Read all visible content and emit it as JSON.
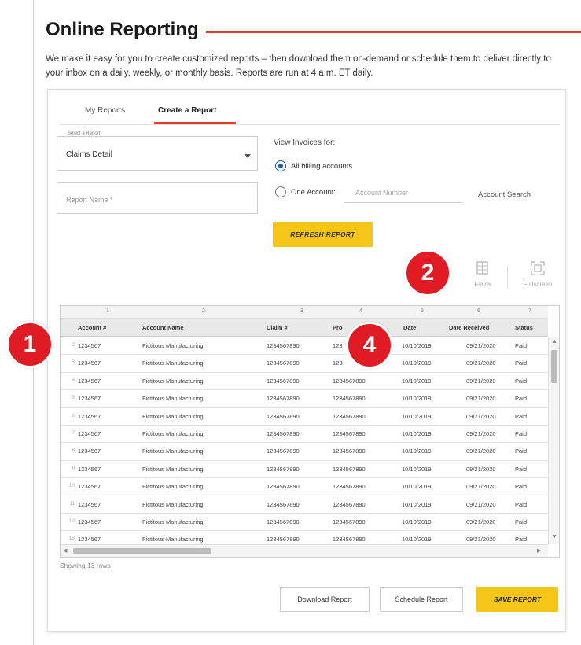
{
  "page": {
    "title": "Online Reporting",
    "intro": "We make it easy for you to create customized reports – then download them on-demand or schedule them to deliver directly to your inbox on a daily, weekly, or monthly basis. Reports are run at 4 a.m. ET daily."
  },
  "tabs": [
    {
      "label": "My Reports",
      "active": false
    },
    {
      "label": "Create a Report",
      "active": true
    }
  ],
  "form": {
    "select_legend": "Select a Report",
    "select_value": "Claims Detail",
    "report_name_placeholder": "Report Name *",
    "view_label": "View Invoices for:",
    "radio_all": "All billing accounts",
    "radio_one": "One Account:",
    "account_placeholder": "Account Number",
    "account_search": "Account Search",
    "refresh_label": "REFRESH REPORT"
  },
  "toolbar": {
    "fields_label": "Fields",
    "fields_icon": "grid-icon",
    "fullscreen_label": "Fullscreen",
    "fullscreen_icon": "expand-icon"
  },
  "grid": {
    "col_numbers": [
      "1",
      "2",
      "3",
      "4",
      "5",
      "6",
      "7"
    ],
    "headers": [
      "Account #",
      "Account Name",
      "Claim #",
      "Pro",
      "Date",
      "Date Received",
      "Status"
    ],
    "rows": [
      {
        "n": "2",
        "acct": "1234567",
        "name": "Fictitous Manufacturing",
        "claim": "1234567890",
        "pro": "123",
        "date": "10/10/2019",
        "received": "09/21/2020",
        "status": "Paid"
      },
      {
        "n": "3",
        "acct": "1234567",
        "name": "Fictitous Manufacturing",
        "claim": "1234567890",
        "pro": "123",
        "date": "10/10/2019",
        "received": "09/21/2020",
        "status": "Paid"
      },
      {
        "n": "4",
        "acct": "1234567",
        "name": "Fictitous Manufacturing",
        "claim": "1234567890",
        "pro": "1234567890",
        "date": "10/10/2019",
        "received": "09/21/2020",
        "status": "Paid"
      },
      {
        "n": "5",
        "acct": "1234567",
        "name": "Fictitous Manufacturing",
        "claim": "1234567890",
        "pro": "1234567890",
        "date": "10/10/2019",
        "received": "09/21/2020",
        "status": "Paid"
      },
      {
        "n": "6",
        "acct": "1234567",
        "name": "Fictitous Manufacturing",
        "claim": "1234567890",
        "pro": "1234567890",
        "date": "10/10/2019",
        "received": "09/21/2020",
        "status": "Paid"
      },
      {
        "n": "7",
        "acct": "1234567",
        "name": "Fictitous Manufacturing",
        "claim": "1234567890",
        "pro": "1234567890",
        "date": "10/10/2019",
        "received": "09/21/2020",
        "status": "Paid"
      },
      {
        "n": "8",
        "acct": "1234567",
        "name": "Fictitous Manufacturing",
        "claim": "1234567890",
        "pro": "1234567890",
        "date": "10/10/2019",
        "received": "09/21/2020",
        "status": "Paid"
      },
      {
        "n": "9",
        "acct": "1234567",
        "name": "Fictitous Manufacturing",
        "claim": "1234567890",
        "pro": "1234567890",
        "date": "10/10/2019",
        "received": "09/21/2020",
        "status": "Paid"
      },
      {
        "n": "10",
        "acct": "1234567",
        "name": "Fictitous Manufacturing",
        "claim": "1234567890",
        "pro": "1234567890",
        "date": "10/10/2019",
        "received": "09/21/2020",
        "status": "Paid"
      },
      {
        "n": "11",
        "acct": "1234567",
        "name": "Fictitous Manufacturing",
        "claim": "1234567890",
        "pro": "1234567890",
        "date": "10/10/2019",
        "received": "09/21/2020",
        "status": "Paid"
      },
      {
        "n": "12",
        "acct": "1234567",
        "name": "Fictitous Manufacturing",
        "claim": "1234567890",
        "pro": "1234567890",
        "date": "10/10/2019",
        "received": "09/21/2020",
        "status": "Paid"
      },
      {
        "n": "13",
        "acct": "1234567",
        "name": "Fictitous Manufacturing",
        "claim": "1234567890",
        "pro": "1234567890",
        "date": "10/10/2019",
        "received": "09/21/2020",
        "status": "Paid"
      }
    ],
    "showing": "Showing 13 rows"
  },
  "actions": {
    "download": "Download Report",
    "schedule": "Schedule Report",
    "save": "SAVE REPORT"
  },
  "callouts": [
    "1",
    "2",
    "4"
  ],
  "colors": {
    "accent_red": "#e23a2c",
    "callout_red": "#e01b24",
    "button_yellow": "#f5c518",
    "radio_blue": "#1a5fb4"
  }
}
